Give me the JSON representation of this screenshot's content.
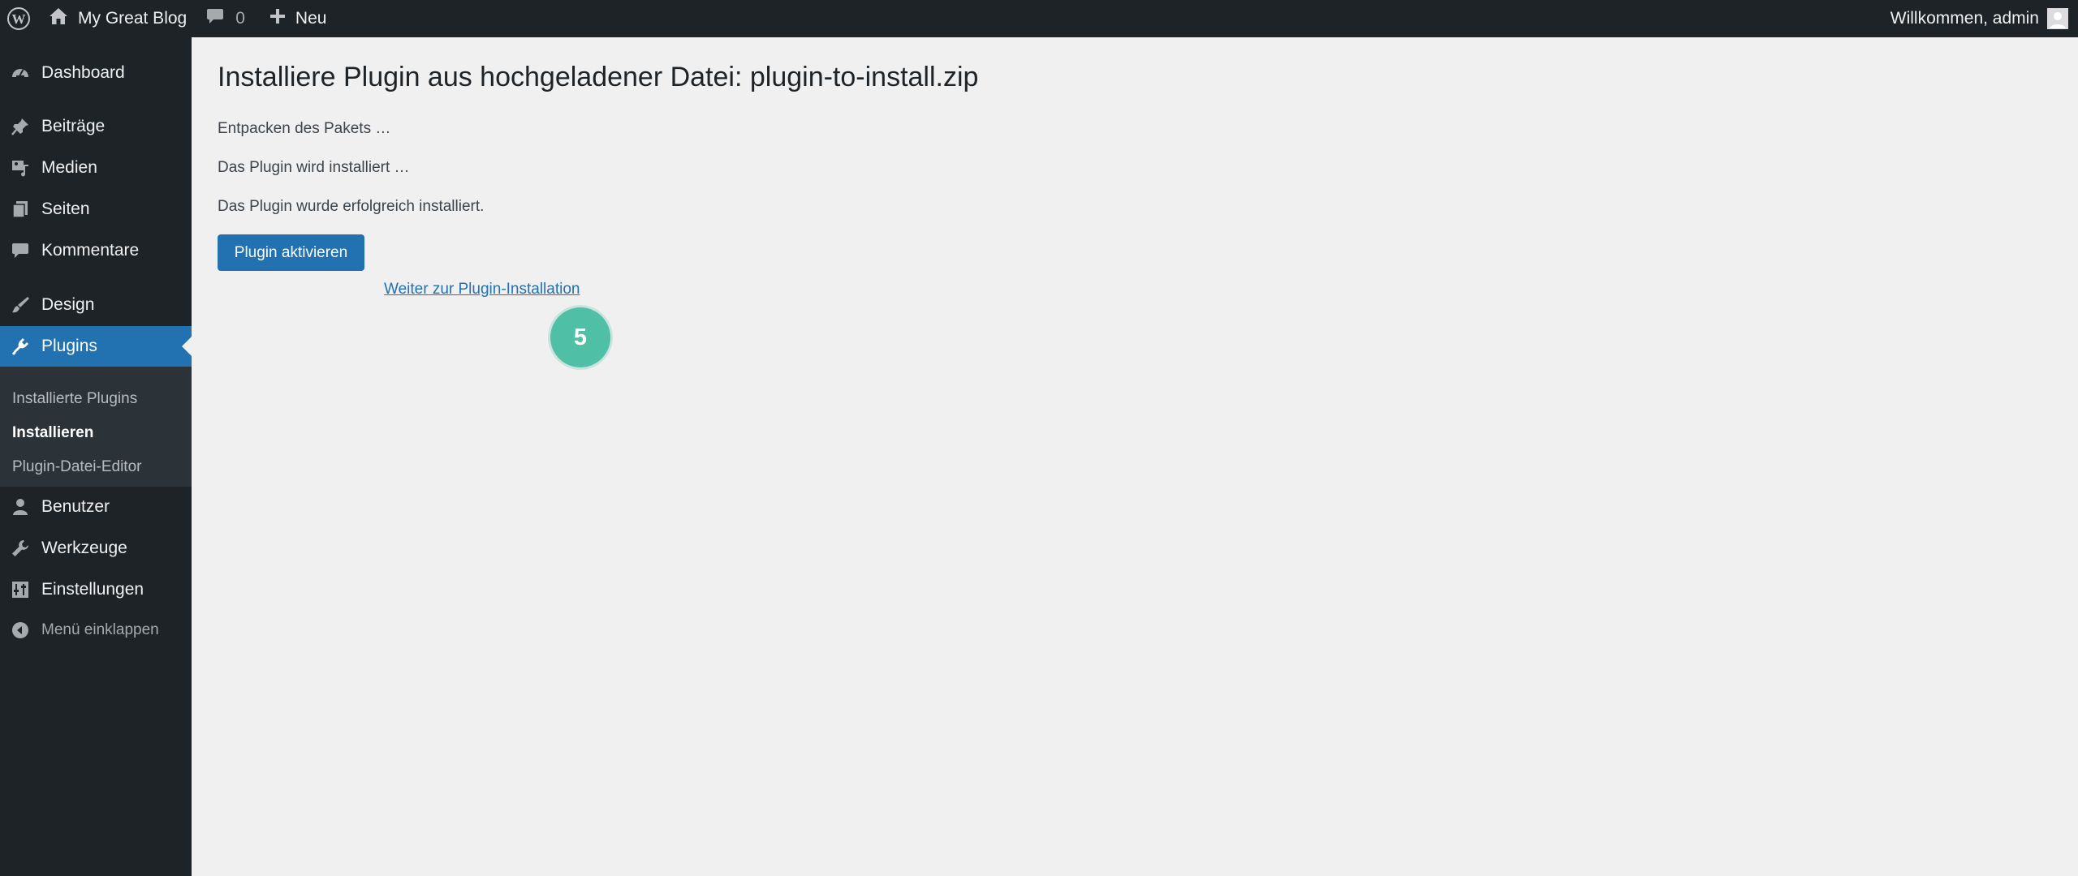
{
  "admin_bar": {
    "site_name": "My Great Blog",
    "comments_count": "0",
    "new_label": "Neu",
    "greeting": "Willkommen, admin"
  },
  "sidebar": {
    "items": [
      {
        "label": "Dashboard",
        "icon": "dashboard-icon"
      },
      {
        "label": "Beiträge",
        "icon": "pin-icon"
      },
      {
        "label": "Medien",
        "icon": "media-icon"
      },
      {
        "label": "Seiten",
        "icon": "pages-icon"
      },
      {
        "label": "Kommentare",
        "icon": "comment-icon"
      },
      {
        "label": "Design",
        "icon": "brush-icon"
      },
      {
        "label": "Plugins",
        "icon": "plugin-icon"
      },
      {
        "label": "Benutzer",
        "icon": "user-icon"
      },
      {
        "label": "Werkzeuge",
        "icon": "wrench-icon"
      },
      {
        "label": "Einstellungen",
        "icon": "settings-icon"
      },
      {
        "label": "Menü einklappen",
        "icon": "collapse-icon"
      }
    ],
    "plugins_submenu": [
      {
        "label": "Installierte Plugins"
      },
      {
        "label": "Installieren"
      },
      {
        "label": "Plugin-Datei-Editor"
      }
    ]
  },
  "main": {
    "title": "Installiere Plugin aus hochgeladener Datei: plugin-to-install.zip",
    "messages": [
      "Entpacken des Pakets …",
      "Das Plugin wird installiert …",
      "Das Plugin wurde erfolgreich installiert."
    ],
    "activate_button": "Plugin aktivieren",
    "continue_link": "Weiter zur Plugin-Installation",
    "step_badge": "5"
  },
  "colors": {
    "admin_bar_bg": "#1d2327",
    "accent": "#2271b1",
    "content_bg": "#f0f0f1",
    "step_badge": "#4fbfa5"
  }
}
